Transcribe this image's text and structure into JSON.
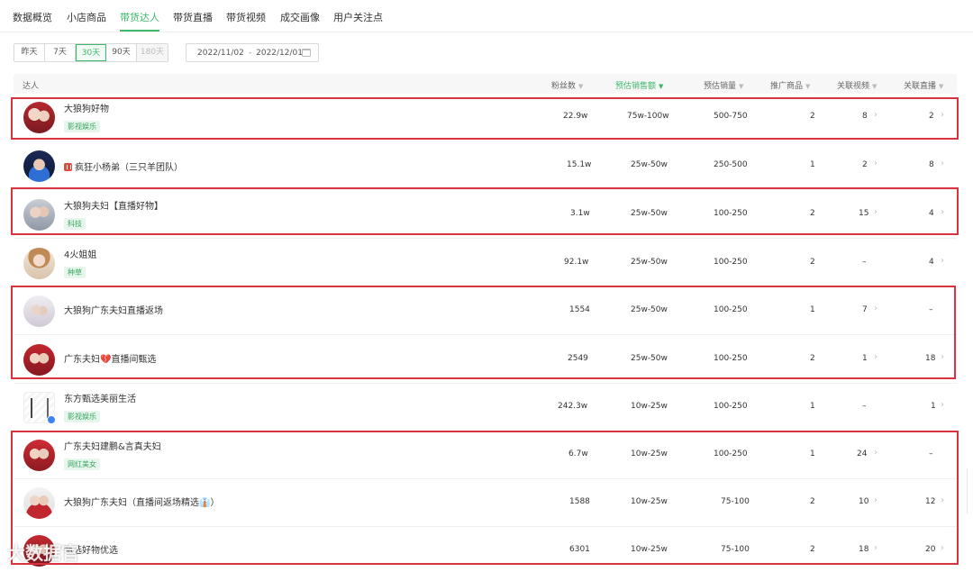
{
  "tabs": [
    {
      "label": "数据概览"
    },
    {
      "label": "小店商品"
    },
    {
      "label": "带货达人"
    },
    {
      "label": "带货直播"
    },
    {
      "label": "带货视频"
    },
    {
      "label": "成交画像"
    },
    {
      "label": "用户关注点"
    }
  ],
  "filters": {
    "ranges": [
      "昨天",
      "7天",
      "30天",
      "90天",
      "180天"
    ],
    "active_range": "30天",
    "disabled_range": "180天",
    "date_start": "2022/11/02",
    "date_sep": "-",
    "date_end": "2022/12/01"
  },
  "table": {
    "headers": {
      "influencer": "达人",
      "fans": "粉丝数",
      "est_sales_amount": "预估销售额",
      "est_sales_volume": "预估销量",
      "promoted_products": "推广商品",
      "related_videos": "关联视频",
      "related_lives": "关联直播"
    },
    "rows": [
      {
        "name": "大狼狗好物",
        "tag": "影视娱乐",
        "fans": "22.9w",
        "amount": "75w-100w",
        "volume": "500-750",
        "products": "2",
        "videos": "8",
        "lives": "2"
      },
      {
        "name": "疯狂小杨弟（三只羊团队）",
        "tag": "",
        "fans": "15.1w",
        "amount": "25w-50w",
        "volume": "250-500",
        "products": "1",
        "videos": "2",
        "lives": "8"
      },
      {
        "name": "大狼狗夫妇【直播好物】",
        "tag": "科技",
        "fans": "3.1w",
        "amount": "25w-50w",
        "volume": "100-250",
        "products": "2",
        "videos": "15",
        "lives": "4"
      },
      {
        "name": "4火姐姐",
        "tag": "种草",
        "fans": "92.1w",
        "amount": "25w-50w",
        "volume": "100-250",
        "products": "2",
        "videos": "–",
        "lives": "4"
      },
      {
        "name": "大狼狗广东夫妇直播返场",
        "tag": "",
        "fans": "1554",
        "amount": "25w-50w",
        "volume": "100-250",
        "products": "1",
        "videos": "7",
        "lives": "–"
      },
      {
        "name": "广东夫妇💔直播间甄选",
        "tag": "",
        "fans": "2549",
        "amount": "25w-50w",
        "volume": "100-250",
        "products": "2",
        "videos": "1",
        "lives": "18"
      },
      {
        "name": "东方甄选美丽生活",
        "tag": "影视娱乐",
        "fans": "242.3w",
        "amount": "10w-25w",
        "volume": "100-250",
        "products": "1",
        "videos": "–",
        "lives": "1"
      },
      {
        "name": "广东夫妇建鹏&言真夫妇",
        "tag": "网红美女",
        "fans": "6.7w",
        "amount": "10w-25w",
        "volume": "100-250",
        "products": "1",
        "videos": "24",
        "lives": "–"
      },
      {
        "name": "大狼狗广东夫妇（直播间返场精选👔）",
        "tag": "",
        "fans": "1588",
        "amount": "10w-25w",
        "volume": "75-100",
        "products": "2",
        "videos": "10",
        "lives": "12"
      },
      {
        "name": "甄选好物优选",
        "tag": "",
        "fans": "6301",
        "amount": "10w-25w",
        "volume": "75-100",
        "products": "2",
        "videos": "18",
        "lives": "20"
      }
    ]
  },
  "watermark": "大数据官",
  "colors": {
    "accent": "#3db86b",
    "highlight": "#d9333f",
    "tag_bg": "#e7f6ec"
  },
  "icons": [
    "calendar-icon",
    "sort-caret-icon",
    "chevron-right-icon",
    "verified-icon",
    "live-icon"
  ]
}
